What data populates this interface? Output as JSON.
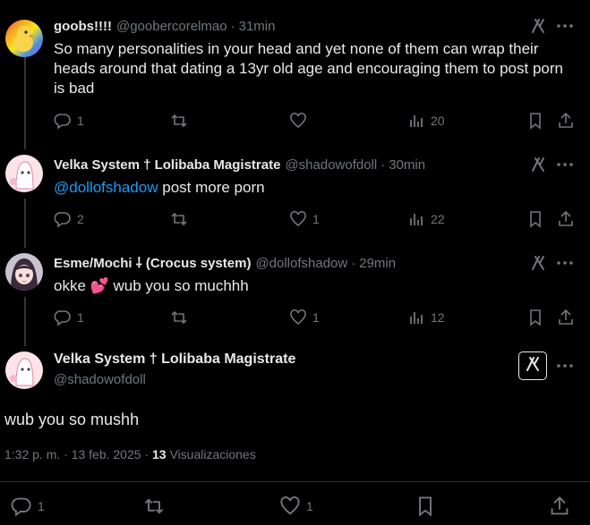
{
  "tweets": [
    {
      "name": "goobs!!!!",
      "handle": "@goobercorelmao",
      "time": "31min",
      "text": "So many personalities in your head and yet none of them can wrap their heads around that dating a 13yr old age and encouraging them to post porn is bad",
      "replies": "1",
      "retweets": "",
      "likes": "",
      "views": "20"
    },
    {
      "name": "Velka System † Lolibaba Magistrate",
      "handle": "@shadowofdoll",
      "time": "30min",
      "mention": "@dollofshadow",
      "text": "post more porn",
      "replies": "2",
      "retweets": "",
      "likes": "1",
      "views": "22"
    },
    {
      "name": "Esme/Mochi ⸸ (Crocus system)",
      "handle": "@dollofshadow",
      "time": "29min",
      "text": "okke 💕 wub you so muchhh",
      "replies": "1",
      "retweets": "",
      "likes": "1",
      "views": "12"
    }
  ],
  "main_tweet": {
    "name": "Velka System † Lolibaba Magistrate",
    "handle": "@shadowofdoll",
    "text": "wub you so mushh",
    "timestamp": "1:32 p. m. · 13 feb. 2025",
    "separator": "·",
    "views_count": "13",
    "views_label": "Visualizaciones",
    "replies": "1",
    "likes": "1"
  },
  "separator": "·",
  "colors": {
    "background": "#000000",
    "text": "#e7e9ea",
    "secondary": "#71767b",
    "link": "#1d9bf0",
    "thread_line": "#333639"
  },
  "icons": [
    "reply-icon",
    "retweet-icon",
    "like-icon",
    "views-icon",
    "bookmark-icon",
    "share-icon",
    "grok-icon",
    "more-icon"
  ]
}
